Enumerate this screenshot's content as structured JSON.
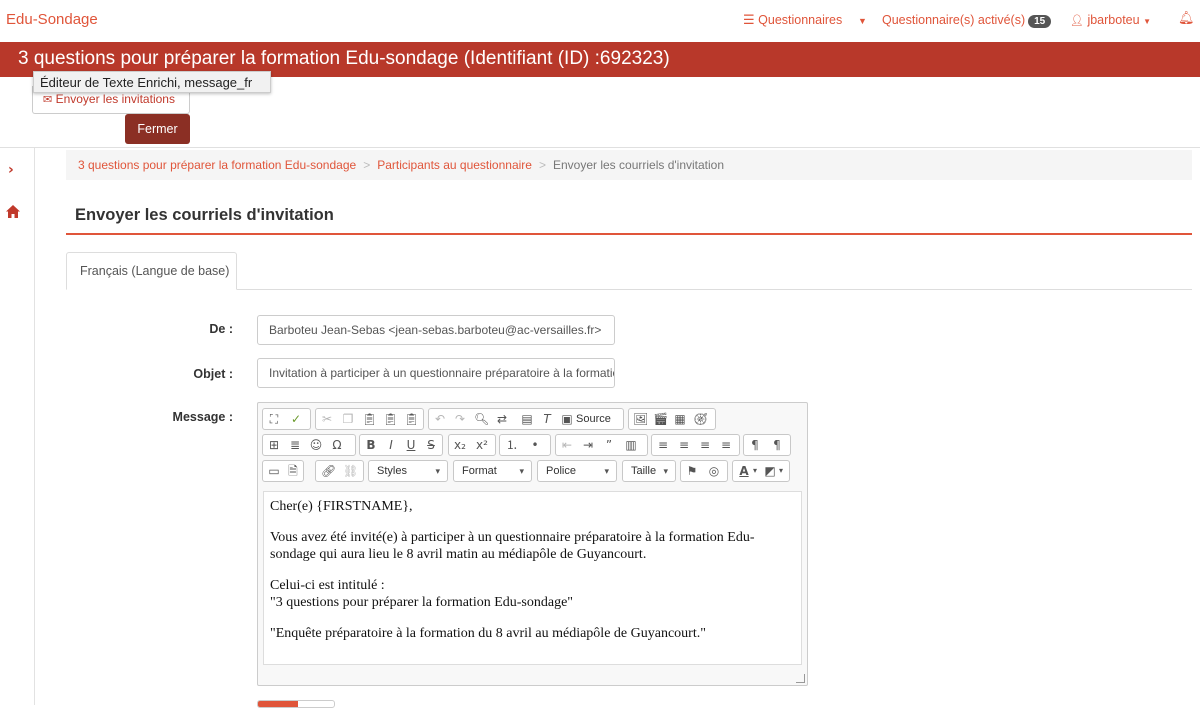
{
  "nav": {
    "brand": "Edu-Sondage",
    "questionnaires": "Questionnaires",
    "active_label": "Questionnaire(s) activé(s)",
    "active_count": "15",
    "user": "jbarboteu"
  },
  "title_bar": {
    "title": "3 questions pour préparer la formation Edu-sondage (Identifiant (ID) :692323)",
    "tooltip": "Éditeur de Texte Enrichi, message_fr",
    "invite_button": "Envoyer les invitations",
    "close_button": "Fermer"
  },
  "breadcrumb": {
    "items": [
      "3 questions pour préparer la formation Edu-sondage",
      "Participants au questionnaire"
    ],
    "separator": ">",
    "current": "Envoyer les courriels d'invitation"
  },
  "page": {
    "heading": "Envoyer les courriels d'invitation",
    "tab": "Français (Langue de base)"
  },
  "form": {
    "from_label": "De :",
    "from_value": "Barboteu Jean-Sebas <jean-sebas.barboteu@ac-versailles.fr>",
    "subject_label": "Objet :",
    "subject_value": "Invitation à participer à un questionnaire préparatoire à la formation Edu-sondage",
    "message_label": "Message :"
  },
  "editor": {
    "source": "Source",
    "styles": "Styles",
    "format": "Format",
    "font": "Police",
    "size": "Taille",
    "body": [
      "Cher(e) {FIRSTNAME},",
      "Vous avez été invité(e) à participer à un questionnaire préparatoire à la formation Edu-sondage qui aura lieu le 8 avril matin au médiapôle de Guyancourt.",
      "Celui-ci est intitulé :",
      "\"3 questions pour préparer la formation Edu-sondage\"",
      "\"Enquête préparatoire à la formation du 8 avril au médiapôle de Guyancourt.\""
    ]
  },
  "colors": {
    "accent": "#e0553a",
    "title_bar": "#b8382a",
    "close_button": "#8b2f24"
  }
}
